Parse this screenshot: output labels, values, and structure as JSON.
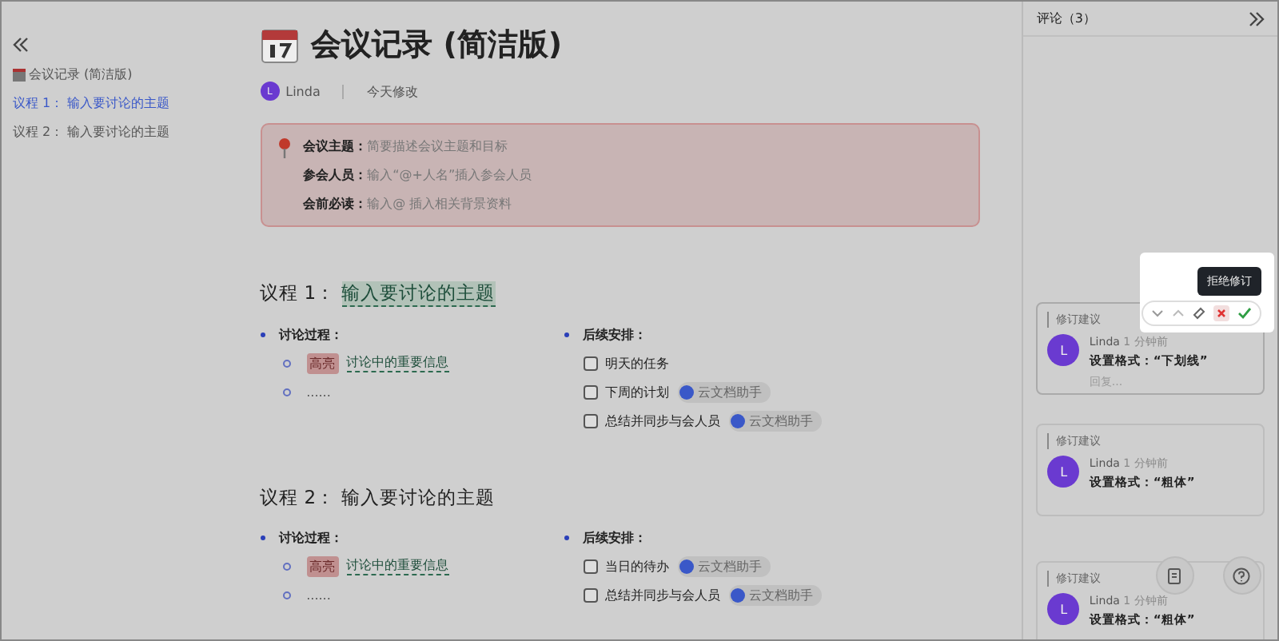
{
  "outline": {
    "items": [
      {
        "label": "会议记录 (简洁版)",
        "selected": false,
        "kind": "doc"
      },
      {
        "label": "议程 1： 输入要讨论的主题",
        "selected": true,
        "kind": "heading"
      },
      {
        "label": "议程 2： 输入要讨论的主题",
        "selected": false,
        "kind": "heading"
      }
    ]
  },
  "doc": {
    "title": "会议记录 (简洁版)",
    "author": "Linda",
    "author_initial": "L",
    "modified": "今天修改",
    "callout": [
      {
        "label": "会议主题：",
        "placeholder": "简要描述会议主题和目标"
      },
      {
        "label": "参会人员：",
        "placeholder": "输入“@+人名”插入参会人员"
      },
      {
        "label": "会前必读：",
        "placeholder": "输入@ 插入相关背景资料"
      }
    ],
    "agendas": [
      {
        "label": "议程 1：",
        "topic": "输入要讨论的主题",
        "revised": true,
        "discussion": {
          "label": "讨论过程：",
          "highlight": "高亮",
          "text": "讨论中的重要信息",
          "more": "......"
        },
        "followup": {
          "label": "后续安排：",
          "tasks": [
            {
              "text": "明天的任务",
              "checked": false
            },
            {
              "text": "下周的计划",
              "checked": false,
              "assignee": "云文档助手"
            },
            {
              "text": "总结并同步与会人员",
              "checked": false,
              "assignee": "云文档助手"
            }
          ]
        }
      },
      {
        "label": "议程 2：",
        "topic": "输入要讨论的主题",
        "revised": false,
        "discussion": {
          "label": "讨论过程：",
          "highlight": "高亮",
          "text": "讨论中的重要信息",
          "more": "......"
        },
        "followup": {
          "label": "后续安排：",
          "tasks": [
            {
              "text": "当日的待办",
              "checked": false,
              "assignee": "云文档助手"
            },
            {
              "text": "总结并同步与会人员",
              "checked": false,
              "assignee": "云文档助手"
            }
          ]
        }
      }
    ]
  },
  "comments": {
    "title": "评论（3）",
    "tooltip": "拒绝修订",
    "items": [
      {
        "tag": "修订建议",
        "author": "Linda",
        "initial": "L",
        "time": "1 分钟前",
        "text": "设置格式：“下划线”",
        "reply": "回复...",
        "active": true
      },
      {
        "tag": "修订建议",
        "author": "Linda",
        "initial": "L",
        "time": "1 分钟前",
        "text": "设置格式：“粗体”",
        "active": false
      },
      {
        "tag": "修订建议",
        "author": "Linda",
        "initial": "L",
        "time": "1 分钟前",
        "text": "设置格式：“粗体”",
        "active": false
      }
    ]
  }
}
